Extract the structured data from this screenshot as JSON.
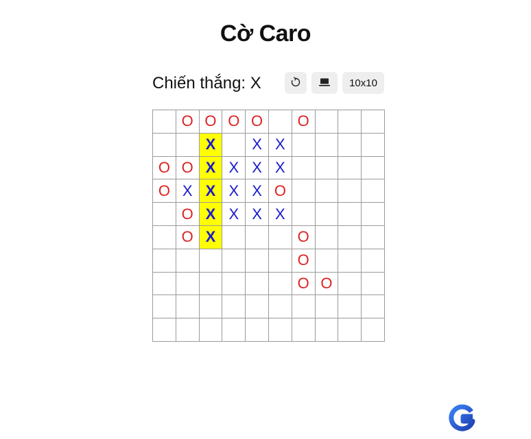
{
  "title": "Cờ Caro",
  "status": "Chiến thắng: X",
  "buttons": {
    "reset_icon": "reset-icon",
    "ai_icon": "laptop-icon",
    "size_label": "10x10"
  },
  "board": {
    "rows": 10,
    "cols": 10,
    "cells": [
      [
        "",
        "O",
        "O",
        "O",
        "O",
        "",
        "O",
        "",
        "",
        ""
      ],
      [
        "",
        "",
        "X",
        "",
        "X",
        "X",
        "",
        "",
        "",
        ""
      ],
      [
        "O",
        "O",
        "X",
        "X",
        "X",
        "X",
        "",
        "",
        "",
        ""
      ],
      [
        "O",
        "X",
        "X",
        "X",
        "X",
        "O",
        "",
        "",
        "",
        ""
      ],
      [
        "",
        "O",
        "X",
        "X",
        "X",
        "X",
        "",
        "",
        "",
        ""
      ],
      [
        "",
        "O",
        "X",
        "",
        "",
        "",
        "O",
        "",
        "",
        ""
      ],
      [
        "",
        "",
        "",
        "",
        "",
        "",
        "O",
        "",
        "",
        ""
      ],
      [
        "",
        "",
        "",
        "",
        "",
        "",
        "O",
        "O",
        "",
        ""
      ],
      [
        "",
        "",
        "",
        "",
        "",
        "",
        "",
        "",
        "",
        ""
      ],
      [
        "",
        "",
        "",
        "",
        "",
        "",
        "",
        "",
        "",
        ""
      ]
    ],
    "winning_cells": [
      [
        1,
        2
      ],
      [
        2,
        2
      ],
      [
        3,
        2
      ],
      [
        4,
        2
      ],
      [
        5,
        2
      ]
    ]
  },
  "colors": {
    "x": "#1a1acc",
    "o": "#dd2222",
    "highlight": "#ffff00"
  },
  "logo_icon": "g-logo-icon"
}
